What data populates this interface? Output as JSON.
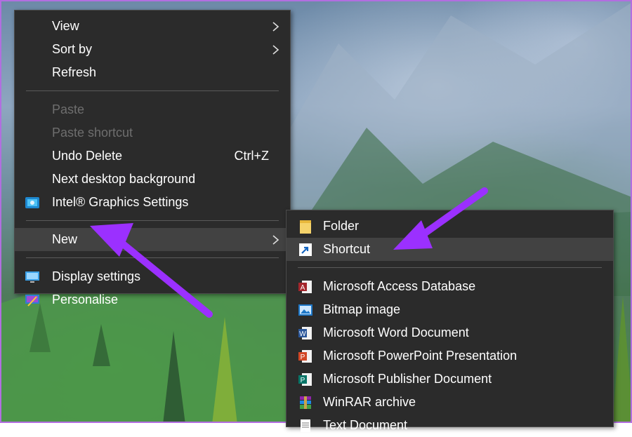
{
  "context_menu": {
    "items": [
      {
        "label": "View"
      },
      {
        "label": "Sort by"
      },
      {
        "label": "Refresh"
      },
      {
        "label": "Paste"
      },
      {
        "label": "Paste shortcut"
      },
      {
        "label": "Undo Delete",
        "shortcut": "Ctrl+Z"
      },
      {
        "label": "Next desktop background"
      },
      {
        "label": "Intel® Graphics Settings"
      },
      {
        "label": "New"
      },
      {
        "label": "Display settings"
      },
      {
        "label": "Personalise"
      }
    ]
  },
  "new_submenu": {
    "items": [
      {
        "label": "Folder",
        "icon": "folder-icon"
      },
      {
        "label": "Shortcut",
        "icon": "shortcut-icon"
      },
      {
        "label": "Microsoft Access Database",
        "icon": "access-icon"
      },
      {
        "label": "Bitmap image",
        "icon": "bitmap-icon"
      },
      {
        "label": "Microsoft Word Document",
        "icon": "word-icon"
      },
      {
        "label": "Microsoft PowerPoint Presentation",
        "icon": "powerpoint-icon"
      },
      {
        "label": "Microsoft Publisher Document",
        "icon": "publisher-icon"
      },
      {
        "label": "WinRAR archive",
        "icon": "winrar-icon"
      },
      {
        "label": "Text Document",
        "icon": "text-document-icon"
      }
    ]
  },
  "colors": {
    "menu_bg": "#2b2b2b",
    "highlight": "#424242",
    "annotation_arrow": "#9b30ff"
  }
}
